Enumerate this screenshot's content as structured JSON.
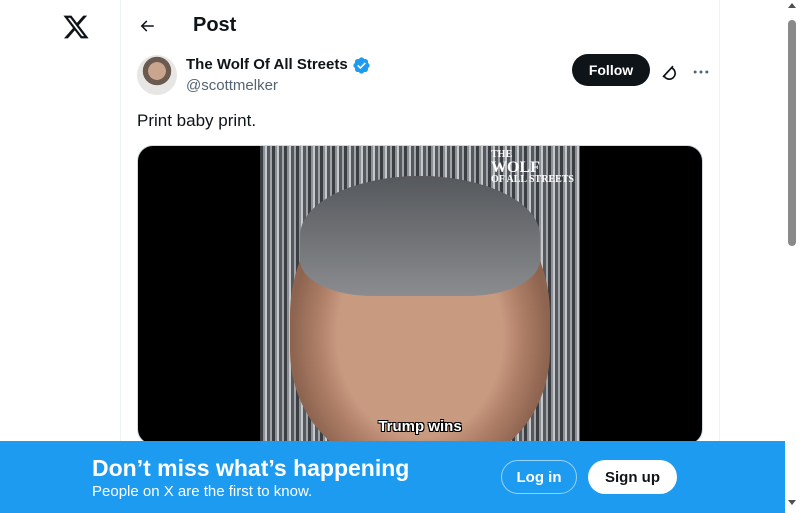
{
  "header": {
    "title": "Post"
  },
  "post": {
    "author_name": "The Wolf Of All Streets",
    "author_handle": "@scottmelker",
    "follow_label": "Follow",
    "text": "Print baby print.",
    "video": {
      "caption": "Trump wins",
      "brand_line1": "THE",
      "brand_line2": "WOLF",
      "brand_line3": "OF ALL STREETS"
    }
  },
  "banner": {
    "title": "Don’t miss what’s happening",
    "subtitle": "People on X are the first to know.",
    "login_label": "Log in",
    "signup_label": "Sign up"
  },
  "icons": {
    "logo": "x-logo-icon",
    "back": "arrow-left-icon",
    "verified": "verified-badge-icon",
    "grok": "grok-icon",
    "more": "more-horizontal-icon"
  },
  "colors": {
    "accent": "#1d9bf0",
    "text": "#0f1419",
    "secondary_text": "#536471"
  }
}
